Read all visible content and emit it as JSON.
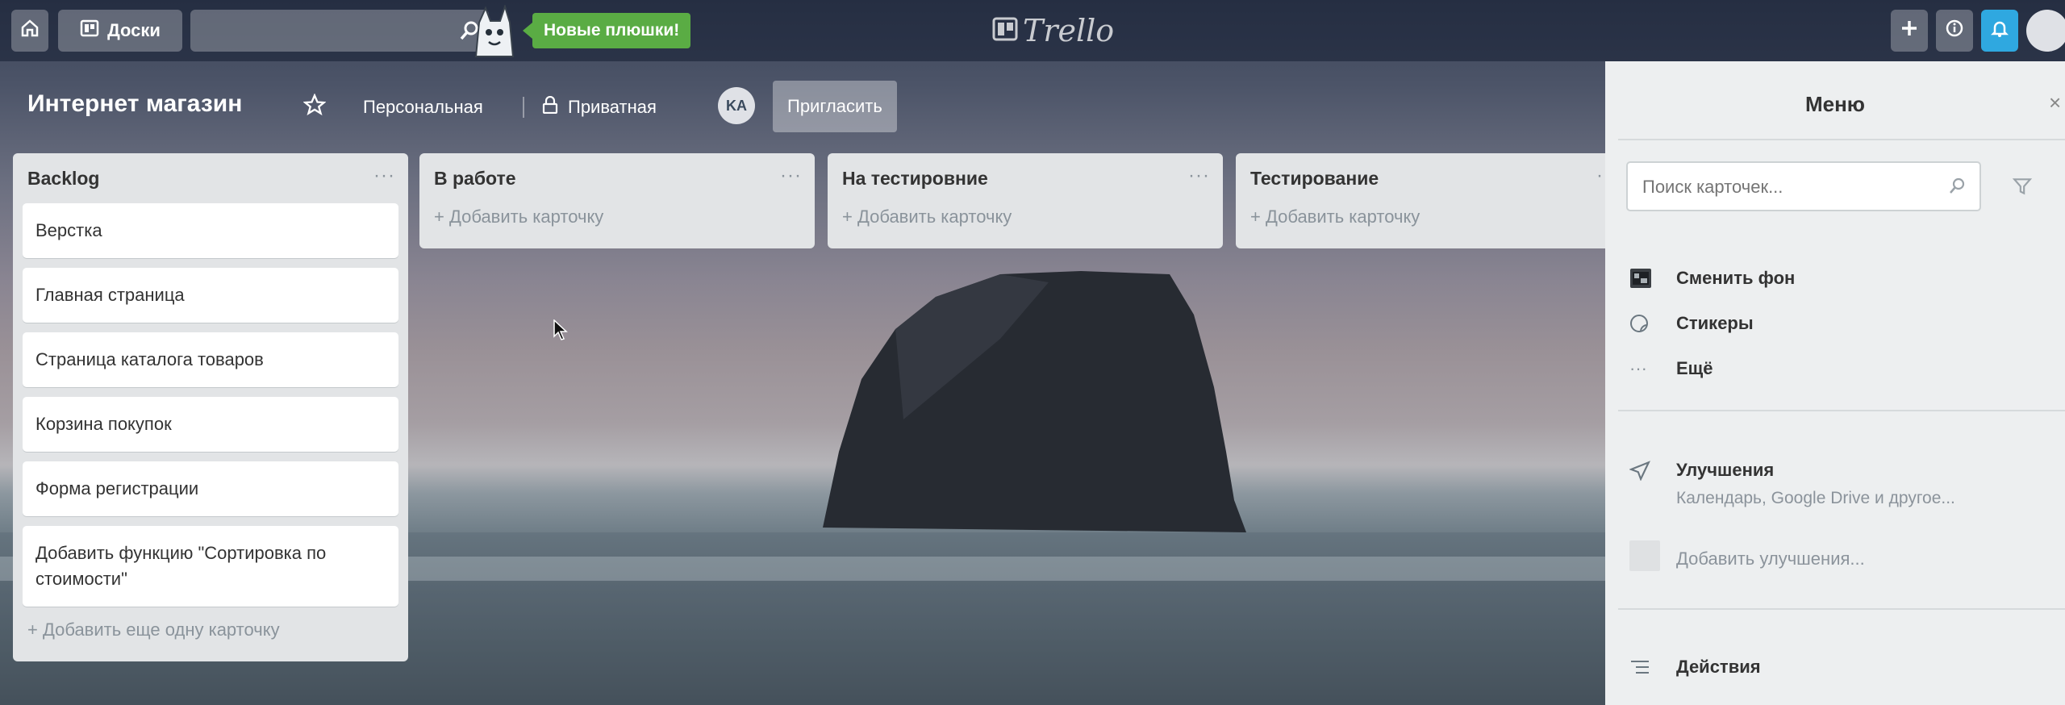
{
  "header": {
    "boards_label": "Доски",
    "search_placeholder": "",
    "promo_label": "Новые плюшки!",
    "logo_text": "Trello"
  },
  "board": {
    "title": "Интернет магазин",
    "team_label": "Персональная",
    "visibility_label": "Приватная",
    "member_initials": "KA",
    "invite_label": "Пригласить"
  },
  "lists": [
    {
      "title": "Backlog",
      "menu": "···",
      "cards": [
        "Верстка",
        "Главная страница",
        "Страница каталога товаров",
        "Корзина покупок",
        "Форма регистрации",
        "Добавить функцию \"Сортировка по стоимости\""
      ],
      "add_label": "+ Добавить еще одну карточку"
    },
    {
      "title": "В работе",
      "menu": "···",
      "cards": [],
      "add_label": "+ Добавить карточку"
    },
    {
      "title": "На тестировние",
      "menu": "···",
      "cards": [],
      "add_label": "+ Добавить карточку"
    },
    {
      "title": "Тестирование",
      "menu": "···",
      "cards": [],
      "add_label": "+ Добавить карточку"
    }
  ],
  "menu": {
    "title": "Меню",
    "search_placeholder": "Поиск карточек...",
    "items": {
      "change_bg": "Сменить фон",
      "stickers": "Стикеры",
      "more": "Ещё",
      "powerups": "Улучшения",
      "powerups_sub": "Календарь, Google Drive и другое...",
      "add_powerups": "Добавить улучшения...",
      "activity": "Действия"
    }
  },
  "colors": {
    "promo": "#5aac44",
    "notification": "#2fa8e0"
  }
}
